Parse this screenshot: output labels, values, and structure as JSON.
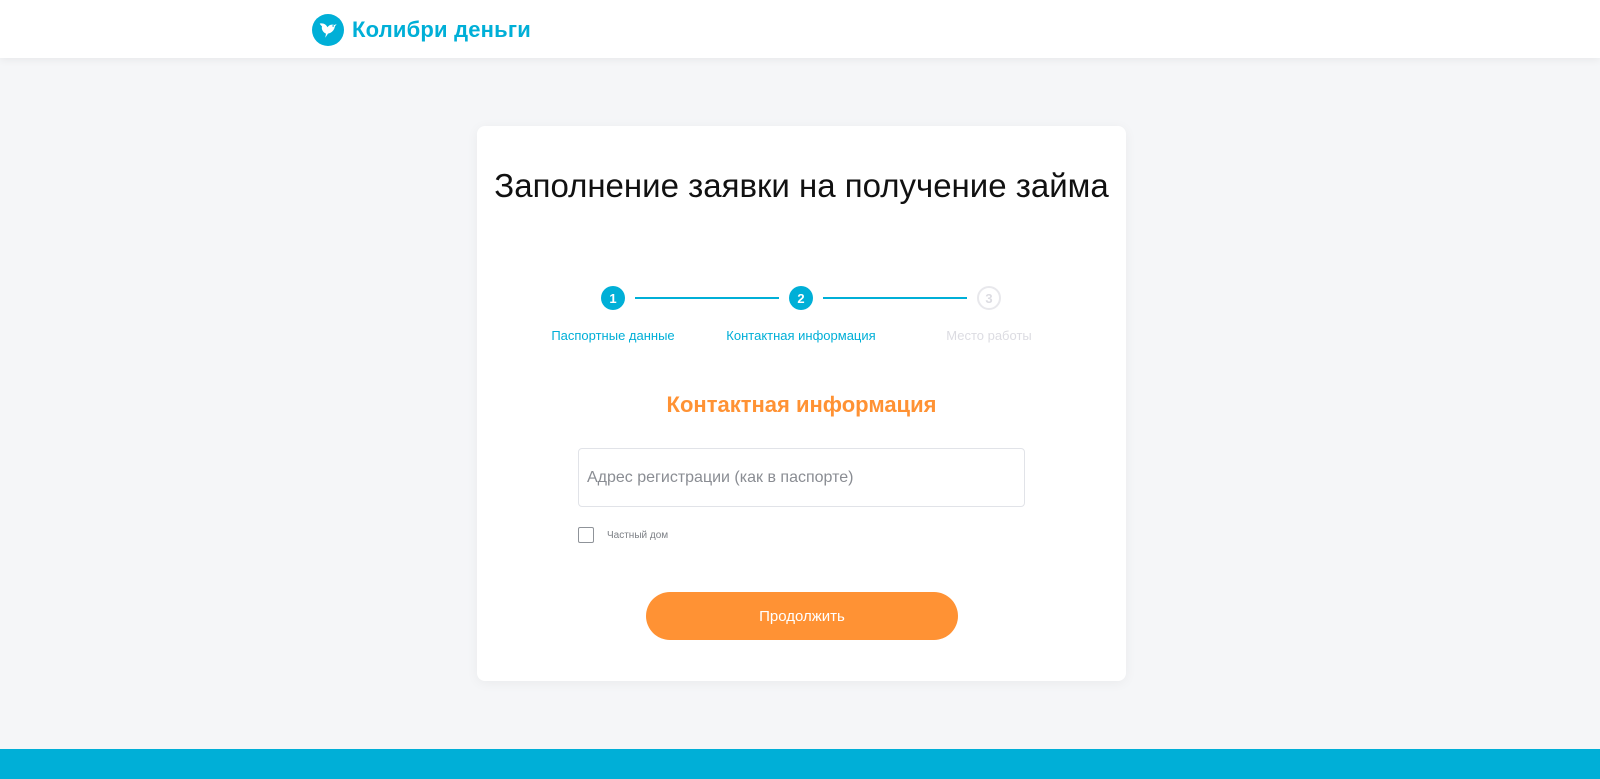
{
  "header": {
    "logo_icon": "hummingbird-icon",
    "logo_text": "Колибри деньги",
    "brand_color": "#00afd7"
  },
  "form": {
    "title": "Заполнение заявки на получение займа",
    "steps": [
      {
        "number": "1",
        "label": "Паспортные данные",
        "state": "completed"
      },
      {
        "number": "2",
        "label": "Контактная информация",
        "state": "current"
      },
      {
        "number": "3",
        "label": "Место работы",
        "state": "upcoming"
      }
    ],
    "section_title": "Контактная информация",
    "address": {
      "placeholder": "Адрес регистрации (как в паспорте)",
      "value": ""
    },
    "private_house": {
      "label": "Частный дом",
      "checked": false
    },
    "submit_label": "Продолжить",
    "accent_color": "#ff9234"
  }
}
